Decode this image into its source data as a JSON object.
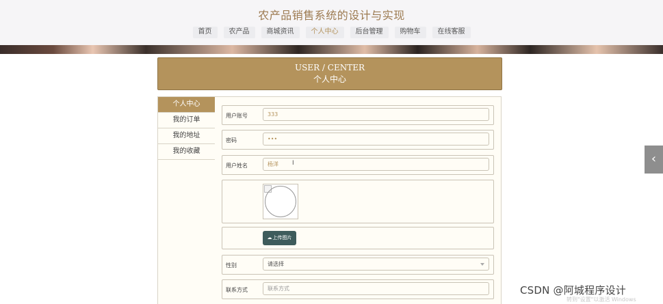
{
  "site_title": "农产品销售系统的设计与实现",
  "nav": [
    "首页",
    "农产品",
    "商城资讯",
    "个人中心",
    "后台管理",
    "购物车",
    "在线客服"
  ],
  "nav_active": "个人中心",
  "page_title": {
    "en": "USER / CENTER",
    "cn": "个人中心"
  },
  "sidebar": {
    "items": [
      {
        "label": "个人中心",
        "active": true
      },
      {
        "label": "我的订单",
        "active": false
      },
      {
        "label": "我的地址",
        "active": false
      },
      {
        "label": "我的收藏",
        "active": false
      }
    ]
  },
  "form": {
    "account": {
      "label": "用户账号",
      "value": "333"
    },
    "password": {
      "label": "密码",
      "value": "•••"
    },
    "name": {
      "label": "用户姓名",
      "value": "杨洋"
    },
    "upload": {
      "label": "上传图片",
      "icon": "cloud-upload-icon"
    },
    "gender": {
      "label": "性别",
      "value": "请选择"
    },
    "contact": {
      "label": "联系方式",
      "placeholder": "联系方式"
    }
  },
  "float_button": {
    "icon": "chevron-left-icon",
    "glyph": "‹"
  },
  "watermark": {
    "text": "CSDN @阿城程序设计",
    "sub": "转到\"设置\"以激活 Windows"
  },
  "colors": {
    "accent": "#b4935c",
    "upload_button": "#3e5c5c",
    "panel_bg": "#fffdf6"
  }
}
